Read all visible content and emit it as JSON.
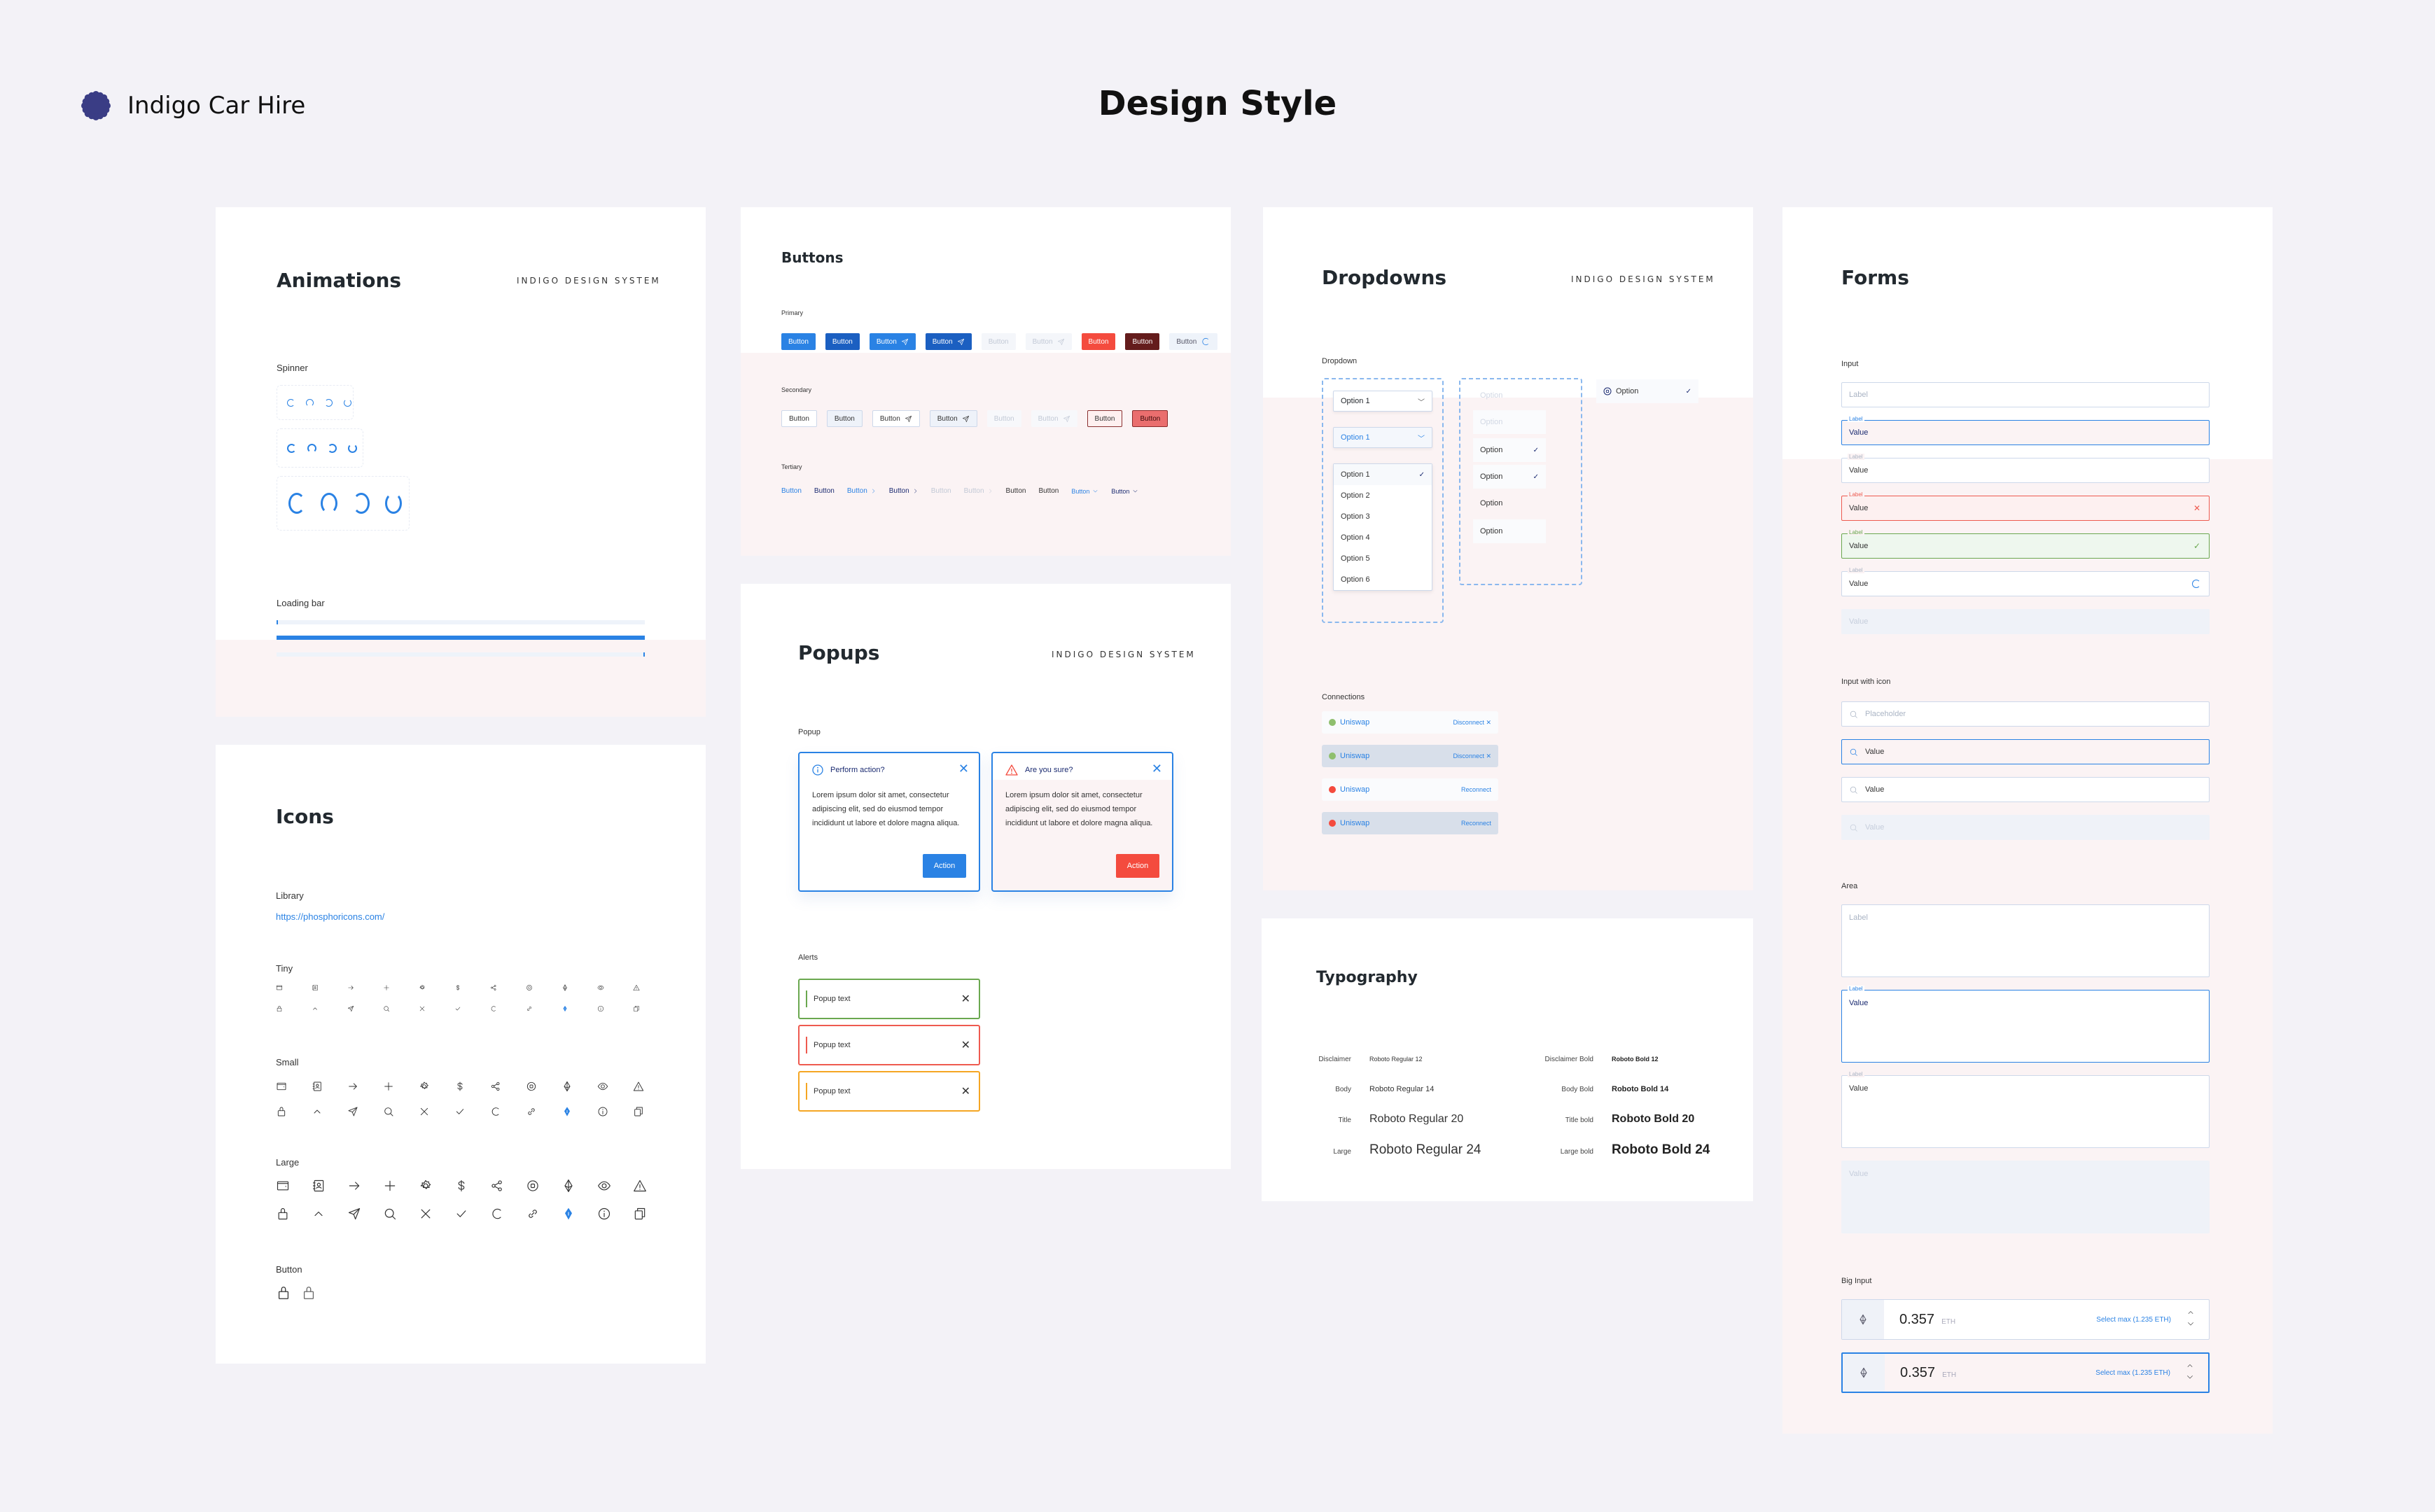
{
  "brand": {
    "name": "Indigo Car Hire",
    "logo_icon": "flower-logo-icon",
    "logo_color": "#3a3d85"
  },
  "page_title": "Design Style",
  "design_system_label": "INDIGO DESIGN SYSTEM",
  "colors": {
    "primary": "#2a82e4",
    "primary_dark": "#1b5fc1",
    "danger": "#f44b3e",
    "maroon": "#641c1c",
    "success": "#6aa84f",
    "warning": "#f5a623",
    "text": "#23282d"
  },
  "animations": {
    "title": "Animations",
    "spinner_label": "Spinner",
    "spinner_sizes": [
      "small",
      "medium",
      "large"
    ],
    "loading_bar_label": "Loading bar",
    "loading_bars": [
      0.0,
      1.0,
      1.0
    ]
  },
  "buttons": {
    "title": "Buttons",
    "primary_label": "Primary",
    "secondary_label": "Secondary",
    "tertiary_label": "Tertiary",
    "button_label": "Button",
    "primary": [
      {
        "variant": "default",
        "icon": null
      },
      {
        "variant": "hover",
        "icon": null
      },
      {
        "variant": "default",
        "icon": "send-icon"
      },
      {
        "variant": "hover",
        "icon": "send-icon"
      },
      {
        "variant": "disabled",
        "icon": null
      },
      {
        "variant": "disabled",
        "icon": "send-icon"
      },
      {
        "variant": "danger",
        "icon": null
      },
      {
        "variant": "danger-pressed",
        "icon": null
      },
      {
        "variant": "loading",
        "icon": "spinner-icon"
      }
    ],
    "secondary": [
      {
        "variant": "default",
        "icon": null
      },
      {
        "variant": "hover",
        "icon": null
      },
      {
        "variant": "default",
        "icon": "send-icon"
      },
      {
        "variant": "hover",
        "icon": "send-icon"
      },
      {
        "variant": "disabled",
        "icon": null
      },
      {
        "variant": "disabled",
        "icon": "send-icon"
      },
      {
        "variant": "danger",
        "icon": null
      },
      {
        "variant": "danger-hover",
        "icon": null
      }
    ],
    "tertiary": [
      {
        "variant": "blue",
        "icon": null
      },
      {
        "variant": "dark",
        "icon": null
      },
      {
        "variant": "blue",
        "icon": "chevron-right-icon"
      },
      {
        "variant": "dark",
        "icon": "chevron-right-icon"
      },
      {
        "variant": "disabled",
        "icon": null
      },
      {
        "variant": "disabled",
        "icon": "chevron-right-icon"
      },
      {
        "variant": "black",
        "icon": null
      },
      {
        "variant": "black",
        "icon": null
      },
      {
        "variant": "blue-small",
        "icon": "chevron-down-icon"
      },
      {
        "variant": "dark-small",
        "icon": "chevron-down-icon"
      }
    ]
  },
  "popups": {
    "title": "Popups",
    "popup_label": "Popup",
    "items": [
      {
        "title": "Perform action?",
        "icon": "info-icon",
        "body": "Lorem ipsum dolor sit amet, consectetur adipiscing elit, sed do eiusmod tempor incididunt ut labore et dolore magna aliqua.",
        "action": "Action",
        "action_color": "#2a82e4"
      },
      {
        "title": "Are you sure?",
        "icon": "warning-icon",
        "body": "Lorem ipsum dolor sit amet, consectetur adipiscing elit, sed do eiusmod tempor incididunt ut labore et dolore magna aliqua.",
        "action": "Action",
        "action_color": "#f44b3e"
      }
    ],
    "alerts_label": "Alerts",
    "alerts": [
      {
        "text": "Popup text",
        "color": "#6aa84f"
      },
      {
        "text": "Popup text",
        "color": "#ee5a4f"
      },
      {
        "text": "Popup text",
        "color": "#f5a623"
      }
    ]
  },
  "dropdowns": {
    "title": "Dropdowns",
    "dropdown_label": "Dropdown",
    "selected": "Option 1",
    "options": [
      "Option 1",
      "Option 2",
      "Option 3",
      "Option 4",
      "Option 5",
      "Option 6"
    ],
    "option_label": "Option",
    "option_states": [
      "disabled",
      "disabled",
      "selected",
      "selected-hover",
      "default",
      "hover"
    ],
    "connections_label": "Connections",
    "connections": [
      {
        "name": "Uniswap",
        "status": "connected",
        "action": "Disconnect",
        "hover": false
      },
      {
        "name": "Uniswap",
        "status": "connected",
        "action": "Disconnect",
        "hover": true
      },
      {
        "name": "Uniswap",
        "status": "disconnected",
        "action": "Reconnect",
        "hover": false
      },
      {
        "name": "Uniswap",
        "status": "disconnected",
        "action": "Reconnect",
        "hover": true
      }
    ]
  },
  "typography": {
    "title": "Typography",
    "rows": [
      {
        "label": "Disclaimer",
        "sample": "Roboto Regular 12",
        "bold_label": "Disclaimer Bold",
        "bold_sample": "Roboto Bold 12"
      },
      {
        "label": "Body",
        "sample": "Roboto Regular 14",
        "bold_label": "Body Bold",
        "bold_sample": "Roboto Bold 14"
      },
      {
        "label": "Title",
        "sample": "Roboto Regular 20",
        "bold_label": "Title bold",
        "bold_sample": "Roboto Bold 20"
      },
      {
        "label": "Large",
        "sample": "Roboto Regular 24",
        "bold_label": "Large bold",
        "bold_sample": "Roboto Bold 24"
      }
    ]
  },
  "forms": {
    "title": "Forms",
    "input_label": "Input",
    "field_label": "Label",
    "field_value": "Value",
    "inputs": [
      "empty",
      "focused",
      "filled",
      "error",
      "success",
      "loading",
      "disabled"
    ],
    "input_with_icon_label": "Input with icon",
    "icon_inputs": [
      {
        "state": "placeholder",
        "text": "Placeholder"
      },
      {
        "state": "focused",
        "text": "Value"
      },
      {
        "state": "filled",
        "text": "Value"
      },
      {
        "state": "disabled",
        "text": "Value"
      }
    ],
    "area_label": "Area",
    "areas": [
      "empty",
      "focused",
      "filled",
      "disabled"
    ],
    "big_input_label": "Big Input",
    "big_inputs": [
      {
        "value": "0.357",
        "unit": "ETH",
        "max_link": "Select max (1.235 ETH)",
        "focused": false
      },
      {
        "value": "0.357",
        "unit": "ETH",
        "max_link": "Select max (1.235 ETH)",
        "focused": true
      }
    ]
  },
  "icons": {
    "title": "Icons",
    "library_label": "Library",
    "library_url": "https://phosphoricons.com/",
    "sizes": [
      "Tiny",
      "Small",
      "Large"
    ],
    "row1": [
      "wallet-icon",
      "address-book-icon",
      "arrow-right-icon",
      "plus-icon",
      "gear-icon",
      "dollar-icon",
      "share-icon",
      "coin-icon",
      "ethereum-icon",
      "eye-icon",
      "warning-icon"
    ],
    "row2": [
      "lock-icon",
      "caret-up-icon",
      "send-icon",
      "search-icon",
      "close-icon",
      "check-icon",
      "spinner-icon",
      "link-icon",
      "pen-nib-icon",
      "info-icon",
      "copy-icon"
    ],
    "button_label": "Button",
    "button_icons": [
      "lock-icon",
      "lock-icon"
    ]
  }
}
